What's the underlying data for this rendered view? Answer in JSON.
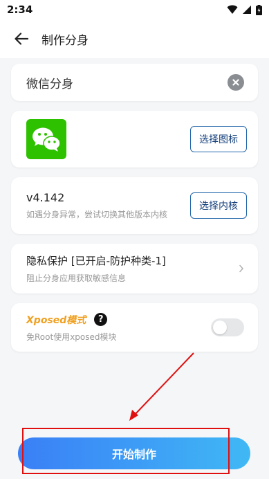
{
  "status_bar": {
    "time": "2:34"
  },
  "header": {
    "title": "制作分身"
  },
  "name_field": {
    "value": "微信分身"
  },
  "icon_section": {
    "button_label": "选择图标"
  },
  "core_section": {
    "version": "v4.142",
    "hint": "如遇分身异常，尝试切换其他版本内核",
    "button_label": "选择内核"
  },
  "privacy_section": {
    "title": "隐私保护 [已开启-防护种类-1]",
    "subtitle": "阻止分身应用获取敏感信息"
  },
  "xposed_section": {
    "title": "Xposed模式",
    "help": "?",
    "subtitle": "免Root使用xposed模块",
    "enabled": false
  },
  "start_button": {
    "label": "开始制作"
  },
  "colors": {
    "accent_blue": "#3a7ff6",
    "xposed_orange": "#f0a020",
    "annotation_red": "#e01010",
    "wechat_green": "#2dc100"
  },
  "icons": {
    "back": "arrow-left-icon",
    "clear": "clear-icon",
    "app": "wechat-icon",
    "chevron": "chevron-right-icon",
    "help": "question-icon"
  }
}
